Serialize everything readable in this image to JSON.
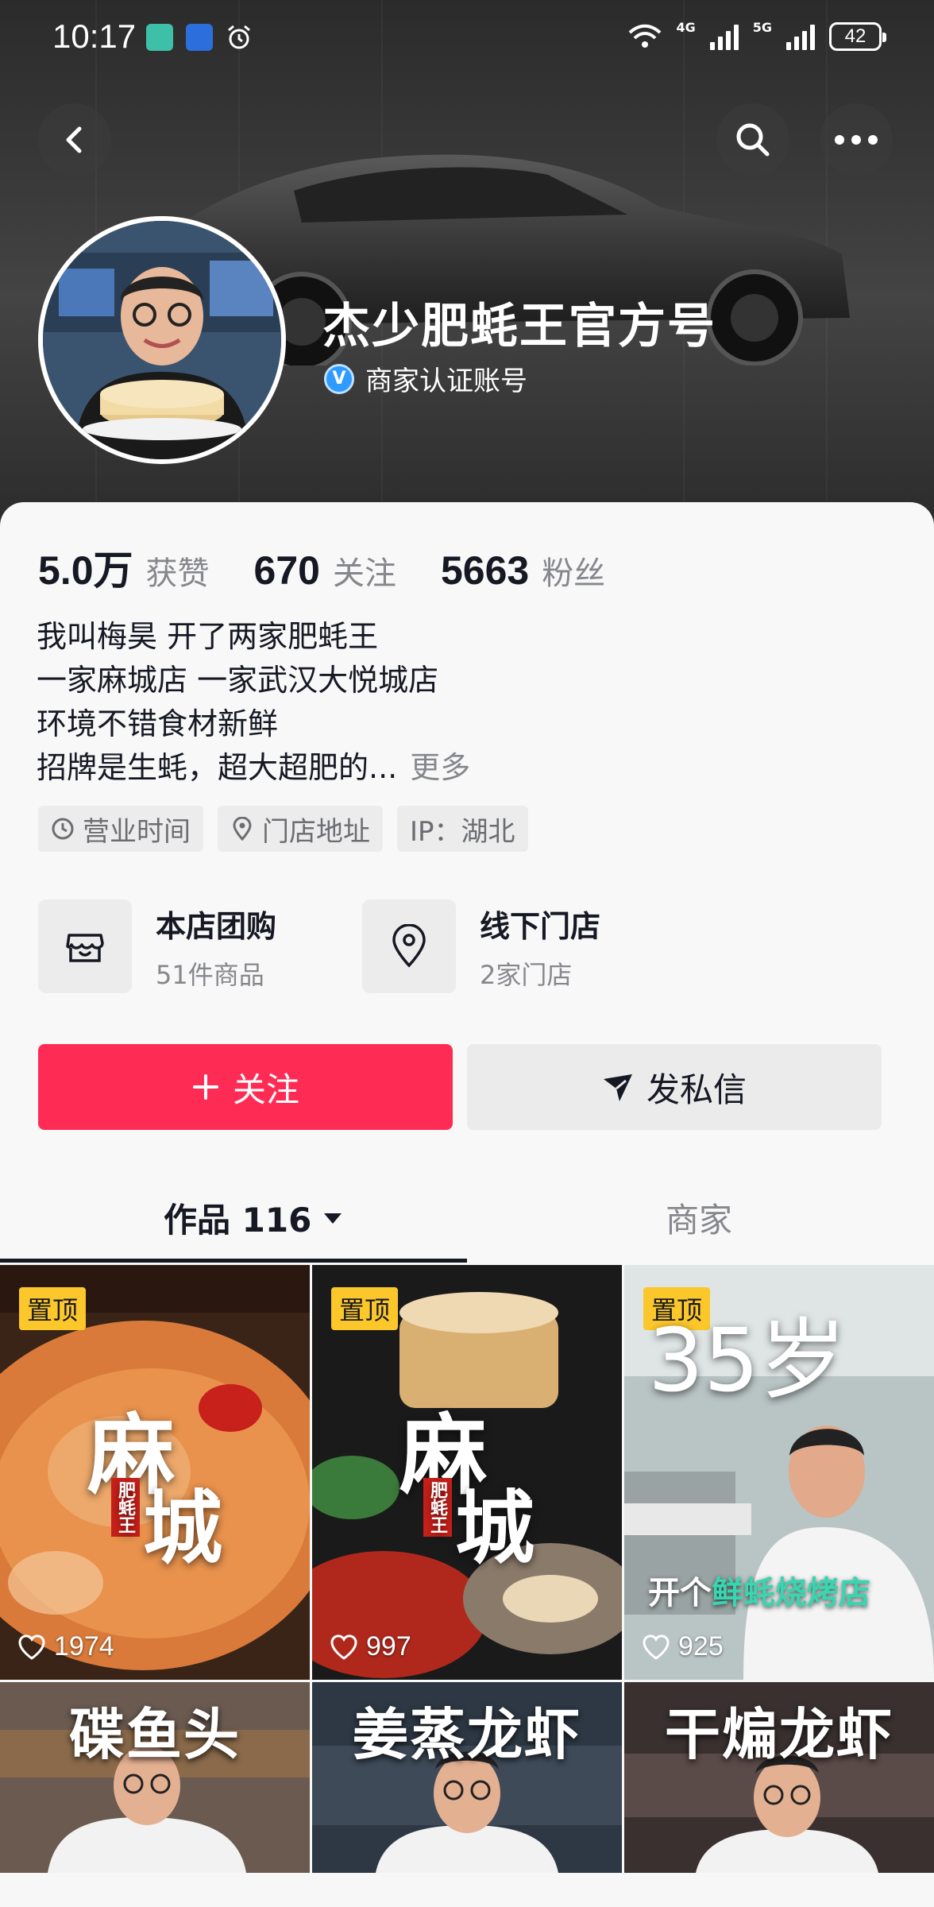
{
  "statusbar": {
    "time": "10:17",
    "net1": "4G",
    "net2": "5G",
    "battery": "42"
  },
  "header": {
    "name": "杰少肥蚝王官方号",
    "verify_label": "商家认证账号",
    "verify_badge": "V",
    "icons": [
      "back-icon",
      "search-icon",
      "more-icon"
    ]
  },
  "stats": [
    {
      "value": "5.0万",
      "label": "获赞"
    },
    {
      "value": "670",
      "label": "关注"
    },
    {
      "value": "5663",
      "label": "粉丝"
    }
  ],
  "bio": {
    "lines": [
      "我叫梅昊 开了两家肥蚝王",
      "一家麻城店 一家武汉大悦城店",
      "环境不错食材新鲜",
      "招牌是生蚝，超大超肥的..."
    ],
    "more": "更多"
  },
  "tags": [
    {
      "label": "营业时间",
      "icon": "clock-icon"
    },
    {
      "label": "门店地址",
      "icon": "location-pin-icon"
    },
    {
      "label": "IP：湖北",
      "icon": ""
    }
  ],
  "shop": {
    "group_title": "本店团购",
    "group_sub": "51件商品",
    "store_title": "线下门店",
    "store_sub": "2家门店"
  },
  "actions": {
    "follow": "关注",
    "message": "发私信"
  },
  "tabs": {
    "works": "作品 116",
    "merchant": "商家"
  },
  "videos": [
    {
      "pinned": "置顶",
      "likes": "1974",
      "overlay_big1": "麻",
      "overlay_big2": "城",
      "overlay_small": "肥蚝王"
    },
    {
      "pinned": "置顶",
      "likes": "997",
      "overlay_big1": "麻",
      "overlay_big2": "城",
      "overlay_small": "肥蚝王"
    },
    {
      "pinned": "置顶",
      "likes": "925",
      "overlay_top": "35岁",
      "caption_plain": "开个",
      "caption_highlight": "鲜蚝烧烤店"
    },
    {
      "overlay_title": "碟鱼头"
    },
    {
      "overlay_title": "姜蒸龙虾"
    },
    {
      "overlay_title": "干煸龙虾"
    }
  ],
  "colors": {
    "accent": "#fe2c55",
    "pin": "#fcc72a",
    "verify": "#2f9bff"
  }
}
